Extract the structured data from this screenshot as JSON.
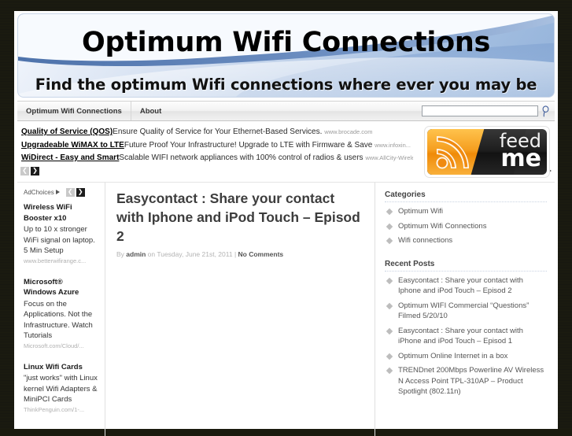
{
  "site": {
    "banner_title": "Optimum Wifi Connections",
    "banner_tagline": "Find the optimum Wifi connections where ever you may be"
  },
  "nav": {
    "items": [
      {
        "label": "Optimum Wifi Connections"
      },
      {
        "label": "About"
      }
    ],
    "search": {
      "value": "",
      "placeholder": "",
      "icon": "search-icon"
    }
  },
  "top_ads": {
    "adchoices_label": "AdChoices",
    "prev_label": "❮",
    "next_label": "❯",
    "items": [
      {
        "title": "Quality of Service (QOS)",
        "description": "Ensure Quality of Service for Your Ethernet-Based Services.",
        "url": "www.brocade.com"
      },
      {
        "title": "Upgradeable WiMAX to LTE",
        "description": "Future Proof Your Infrastructure! Upgrade to LTE with Firmware & Save",
        "url": "www.infoxin..."
      },
      {
        "title": "WiDirect - Easy and Smart",
        "description": "Scalable WIFI network appliances with 100% control of radios & users",
        "url": "www.AllCity-Wirele..."
      }
    ]
  },
  "feed_badge": {
    "word_top": "feed",
    "word_bottom": "me",
    "icon": "rss-icon",
    "orange": "#f59e1f",
    "dark": "#1d1d1d"
  },
  "left_sidebar": {
    "adchoices_label": "AdChoices",
    "prev_label": "❮",
    "next_label": "❯",
    "ads": [
      {
        "title_line1": "Wireless WiFi",
        "title_line2": "Booster x10",
        "description": "Up to 10 x stronger WiFi signal on laptop. 5 Min Setup",
        "url": "www.betterwifirange.c..."
      },
      {
        "title_line1": "Microsoft®",
        "title_line2": "Windows Azure",
        "description": "Focus on the Applications. Not the Infrastructure. Watch Tutorials",
        "url": "Microsoft.com/Cloud/..."
      },
      {
        "title_line1": "Linux Wifi Cards",
        "title_line2": "",
        "description": "\"just works\" with Linux kernel Wifi Adapters & MiniPCI Cards",
        "url": "ThinkPenguin.com/1-..."
      }
    ]
  },
  "post": {
    "title": "Easycontact : Share your contact with Iphone and iPod Touch – Episod 2",
    "meta_prefix": "By ",
    "author": "admin",
    "meta_mid": " on Tuesday, June 21st, 2011 | ",
    "comments": "No Comments"
  },
  "right_sidebar": {
    "categories_heading": "Categories",
    "categories": [
      "Optimum Wifi",
      "Optimum Wifi Connections",
      "Wifi connections"
    ],
    "recent_heading": "Recent Posts",
    "recent_posts": [
      "Easycontact : Share your contact with Iphone and iPod Touch – Episod 2",
      "Optimum WIFI Commercial “Questions” Filmed 5/20/10",
      "Easycontact : Share your contact with iPhone and iPod Touch – Episod 1",
      "Optimum Online Internet in a box",
      "TRENDnet 200Mbps Powerline AV Wireless N Access Point TPL-310AP – Product Spotlight (802.11n)"
    ]
  }
}
